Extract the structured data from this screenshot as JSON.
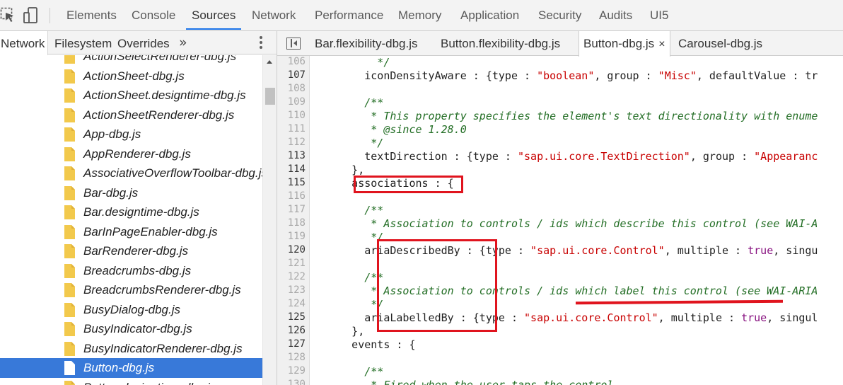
{
  "toolbar": {
    "tabs": [
      "Elements",
      "Console",
      "Sources",
      "Network",
      "Performance",
      "Memory",
      "Application",
      "Security",
      "Audits",
      "UI5"
    ],
    "active_tab": "Sources",
    "accent_color": "#1a73e8"
  },
  "navigator": {
    "tabs": [
      "Network",
      "Filesystem",
      "Overrides"
    ],
    "more_label": "»",
    "files": [
      "ActionSelectRenderer-dbg.js",
      "ActionSheet-dbg.js",
      "ActionSheet.designtime-dbg.js",
      "ActionSheetRenderer-dbg.js",
      "App-dbg.js",
      "AppRenderer-dbg.js",
      "AssociativeOverflowToolbar-dbg.js",
      "Bar-dbg.js",
      "Bar.designtime-dbg.js",
      "BarInPageEnabler-dbg.js",
      "BarRenderer-dbg.js",
      "Breadcrumbs-dbg.js",
      "BreadcrumbsRenderer-dbg.js",
      "BusyDialog-dbg.js",
      "BusyIndicator-dbg.js",
      "BusyIndicatorRenderer-dbg.js",
      "Button-dbg.js",
      "Button.designtime-dbg.js"
    ],
    "selected_file": "Button-dbg.js",
    "folder_color": "#f2c94c",
    "selection_color": "#3879d9"
  },
  "editor": {
    "tabs": [
      "Bar.flexibility-dbg.js",
      "Button.flexibility-dbg.js",
      "Button-dbg.js",
      "Carousel-dbg.js"
    ],
    "active_tab": "Button-dbg.js",
    "close_glyph": "×",
    "lines": [
      {
        "n": "106",
        "t": "*/",
        "indent": 5,
        "kind": "comment",
        "partial": true
      },
      {
        "n": "107",
        "t": "iconDensityAware : {type : \"boolean\", group : \"Misc\", defaultValue : tr",
        "indent": 4,
        "kind": "code"
      },
      {
        "n": "108",
        "t": "",
        "indent": 0,
        "kind": "code"
      },
      {
        "n": "109",
        "t": "/**",
        "indent": 4,
        "kind": "comment"
      },
      {
        "n": "110",
        "t": " * This property specifies the element's text directionality with enume",
        "indent": 4,
        "kind": "comment"
      },
      {
        "n": "111",
        "t": " * @since 1.28.0",
        "indent": 4,
        "kind": "comment"
      },
      {
        "n": "112",
        "t": " */",
        "indent": 4,
        "kind": "comment"
      },
      {
        "n": "113",
        "t": "textDirection : {type : \"sap.ui.core.TextDirection\", group : \"Appearanc",
        "indent": 4,
        "kind": "code"
      },
      {
        "n": "114",
        "t": "},",
        "indent": 3,
        "kind": "code"
      },
      {
        "n": "115",
        "t": "associations : {",
        "indent": 3,
        "kind": "code"
      },
      {
        "n": "116",
        "t": "",
        "indent": 0,
        "kind": "code"
      },
      {
        "n": "117",
        "t": "/**",
        "indent": 4,
        "kind": "comment"
      },
      {
        "n": "118",
        "t": " * Association to controls / ids which describe this control (see WAI-A",
        "indent": 4,
        "kind": "comment"
      },
      {
        "n": "119",
        "t": " */",
        "indent": 4,
        "kind": "comment"
      },
      {
        "n": "120",
        "t": "ariaDescribedBy : {type : \"sap.ui.core.Control\", multiple : true, singu",
        "indent": 4,
        "kind": "code"
      },
      {
        "n": "121",
        "t": "",
        "indent": 0,
        "kind": "code"
      },
      {
        "n": "122",
        "t": "/**",
        "indent": 4,
        "kind": "comment"
      },
      {
        "n": "123",
        "t": " * Association to controls / ids which label this control (see WAI-ARIA",
        "indent": 4,
        "kind": "comment"
      },
      {
        "n": "124",
        "t": " */",
        "indent": 4,
        "kind": "comment"
      },
      {
        "n": "125",
        "t": "ariaLabelledBy : {type : \"sap.ui.core.Control\", multiple : true, singul",
        "indent": 4,
        "kind": "code"
      },
      {
        "n": "126",
        "t": "},",
        "indent": 3,
        "kind": "code"
      },
      {
        "n": "127",
        "t": "events : {",
        "indent": 3,
        "kind": "code"
      },
      {
        "n": "128",
        "t": "",
        "indent": 0,
        "kind": "code"
      },
      {
        "n": "129",
        "t": "/**",
        "indent": 4,
        "kind": "comment"
      },
      {
        "n": "130",
        "t": " * Fired when the user taps the control.",
        "indent": 4,
        "kind": "comment",
        "partial": true
      }
    ],
    "highlighted_line_numbers": [
      "107",
      "113",
      "114",
      "115",
      "120",
      "125",
      "126",
      "127"
    ],
    "colors": {
      "comment": "#236e25",
      "string": "#c80000",
      "keyword": "#881280",
      "annotation": "#e0141e"
    }
  }
}
